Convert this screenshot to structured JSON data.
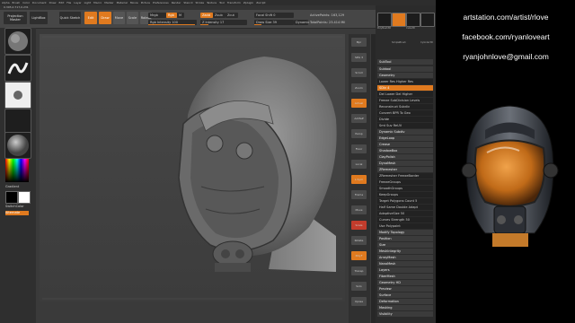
{
  "menu": [
    "Alpha",
    "Brush",
    "Color",
    "Document",
    "Draw",
    "Edit",
    "File",
    "Layer",
    "Light",
    "Macro",
    "Marker",
    "Material",
    "Movie",
    "Picture",
    "Preferences",
    "Render",
    "Stencil",
    "Stroke",
    "Texture",
    "Tool",
    "Transform",
    "Zplugin",
    "Zscript"
  ],
  "info": "0.305,0.717,0.231",
  "toolbar": {
    "projection_label": "Projection Master",
    "lightbox_label": "LightBox",
    "quicksketch_label": "Quick Sketch",
    "edit_label": "Edit",
    "draw_label": "Draw",
    "move_label": "Move",
    "scale_label": "Scale",
    "rotate_label": "Rotate",
    "mrgb": "Mrgb",
    "rgb": "Rgb",
    "m": "M",
    "zadd": "Zadd",
    "zsub": "Zsub",
    "zcut": "Zcut",
    "rgb_intensity": "Rgb Intensity 100",
    "z_intensity": "Z Intensity 17",
    "focal_shift": "Focal Shift 0",
    "draw_size": "Draw Size 39",
    "dynamic": "Dynamic",
    "active_points": "ActivePoints: 163,129",
    "total_points": "TotalPoints: 23.414 Mil"
  },
  "left_tray": {
    "gradient_label": "Gradient",
    "switch_color_label": "SwitchColor",
    "alternate_label": "Alternate"
  },
  "right_shelf": [
    "Bpr",
    "SPix 3",
    "Scroll",
    "Zoom",
    "Actual",
    "AAHalf",
    "Persp",
    "Floor",
    "Local",
    "L.Sym",
    "Frame",
    "Move",
    "Scale",
    "Rotate",
    "PolyF",
    "Transp",
    "Solo",
    "Xpose"
  ],
  "panel": {
    "title": "SubTool",
    "tool_names": [
      "PolyMesh3D",
      "SimpleBrush",
      "Cube3D",
      "Cylinder3D"
    ],
    "rows": [
      {
        "label": "Subtool",
        "style": "hd"
      },
      {
        "label": "Geometry",
        "style": "hd"
      },
      {
        "label": "Lower Res  Higher Res",
        "style": "sl"
      },
      {
        "label": "SDiv 4",
        "style": "or"
      },
      {
        "label": "Del Lower  Del Higher",
        "style": "sl"
      },
      {
        "label": "Freeze SubDivision Levels",
        "style": "sl"
      },
      {
        "label": "Reconstruct Subdiv",
        "style": "sl"
      },
      {
        "label": "Convert BPR To Geo",
        "style": "sl"
      },
      {
        "label": "Divide",
        "style": "sl"
      },
      {
        "label": "Smt  Suv  ReUV",
        "style": "sl"
      },
      {
        "label": "Dynamic Subdiv",
        "style": "hd"
      },
      {
        "label": "EdgeLoop",
        "style": "hd"
      },
      {
        "label": "Crease",
        "style": "hd"
      },
      {
        "label": "ShadowBox",
        "style": "hd"
      },
      {
        "label": "ClayPolish",
        "style": "hd"
      },
      {
        "label": "DynaMesh",
        "style": "hd"
      },
      {
        "label": "ZRemesher",
        "style": "hd"
      },
      {
        "label": "ZRemesher  FreezeBorder",
        "style": "sl"
      },
      {
        "label": "FreezeGroups",
        "style": "sl"
      },
      {
        "label": "SmoothGroups",
        "style": "sl"
      },
      {
        "label": "KeepGroups",
        "style": "sl"
      },
      {
        "label": "Target Polygons Count 5",
        "style": "sl"
      },
      {
        "label": "Half  Same  Double  Adapt",
        "style": "sl"
      },
      {
        "label": "AdaptiveSize 50",
        "style": "sl"
      },
      {
        "label": "Curves Strength 50",
        "style": "sl"
      },
      {
        "label": "Use Polypaint",
        "style": "sl"
      },
      {
        "label": "Modify Topology",
        "style": "hd"
      },
      {
        "label": "Position",
        "style": "hd"
      },
      {
        "label": "Size",
        "style": "hd"
      },
      {
        "label": "MeshIntegrity",
        "style": "hd"
      },
      {
        "label": "ArrayMesh",
        "style": "hd"
      },
      {
        "label": "NanoMesh",
        "style": "hd"
      },
      {
        "label": "Layers",
        "style": "hd"
      },
      {
        "label": "FiberMesh",
        "style": "hd"
      },
      {
        "label": "Geometry HD",
        "style": "hd"
      },
      {
        "label": "Preview",
        "style": "hd"
      },
      {
        "label": "Surface",
        "style": "hd"
      },
      {
        "label": "Deformation",
        "style": "hd"
      },
      {
        "label": "Masking",
        "style": "hd"
      },
      {
        "label": "Visibility",
        "style": "hd"
      }
    ]
  },
  "social": {
    "artstation": "artstation.com/artist/rlove",
    "facebook": "facebook.com/ryanloveart",
    "email": "ryanjohnlove@gmail.com"
  },
  "colors": {
    "accent": "#e07a1f",
    "helmet_visor": "#d9822b"
  }
}
